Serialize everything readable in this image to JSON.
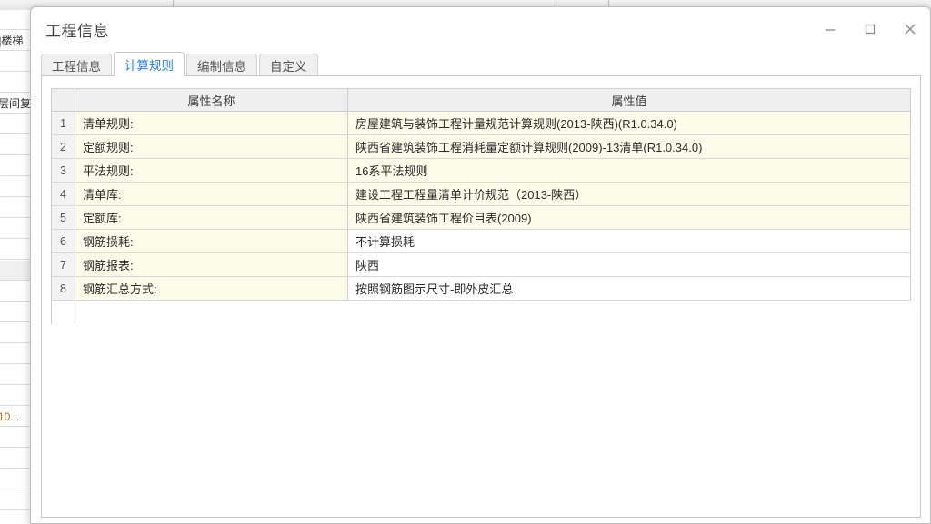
{
  "background_window": {
    "toolbar_separators": [
      190,
      611,
      669
    ],
    "side_rows": [
      {
        "text": "",
        "shaded": false,
        "header": false,
        "orange": false
      },
      {
        "text": "]楼梯",
        "shaded": false,
        "header": false,
        "orange": false
      },
      {
        "text": "",
        "shaded": false,
        "header": false,
        "orange": false
      },
      {
        "text": "",
        "shaded": false,
        "header": false,
        "orange": false
      },
      {
        "text": "层间复",
        "shaded": false,
        "header": false,
        "orange": false
      },
      {
        "text": "",
        "shaded": false,
        "header": false,
        "orange": false
      },
      {
        "text": "",
        "shaded": false,
        "header": false,
        "orange": false
      },
      {
        "text": "",
        "shaded": false,
        "header": false,
        "orange": false
      },
      {
        "text": "",
        "shaded": false,
        "header": false,
        "orange": false
      },
      {
        "text": "",
        "shaded": false,
        "header": false,
        "orange": false
      },
      {
        "text": "",
        "shaded": false,
        "header": false,
        "orange": false
      },
      {
        "text": "",
        "shaded": false,
        "header": false,
        "orange": false
      },
      {
        "text": "",
        "shaded": true,
        "header": false,
        "orange": false
      },
      {
        "text": "",
        "shaded": false,
        "header": false,
        "orange": false
      },
      {
        "text": "",
        "shaded": false,
        "header": false,
        "orange": false
      },
      {
        "text": "",
        "shaded": false,
        "header": false,
        "orange": false
      },
      {
        "text": "",
        "shaded": false,
        "header": false,
        "orange": false
      },
      {
        "text": "",
        "shaded": false,
        "header": false,
        "orange": false
      },
      {
        "text": "",
        "shaded": false,
        "header": false,
        "orange": false
      },
      {
        "text": "10...",
        "shaded": false,
        "header": false,
        "orange": true
      },
      {
        "text": "",
        "shaded": false,
        "header": false,
        "orange": false
      },
      {
        "text": "",
        "shaded": false,
        "header": false,
        "orange": false
      },
      {
        "text": "",
        "shaded": false,
        "header": false,
        "orange": false
      },
      {
        "text": "",
        "shaded": false,
        "header": false,
        "orange": false
      },
      {
        "text": "",
        "shaded": false,
        "header": false,
        "orange": false
      }
    ]
  },
  "dialog": {
    "title": "工程信息",
    "window_controls": {
      "minimize": "minimize",
      "maximize": "maximize",
      "close": "close"
    },
    "tabs": [
      {
        "label": "工程信息",
        "active": false
      },
      {
        "label": "计算规则",
        "active": true
      },
      {
        "label": "编制信息",
        "active": false
      },
      {
        "label": "自定义",
        "active": false
      }
    ],
    "grid": {
      "columns": [
        "",
        "属性名称",
        "属性值"
      ],
      "rows": [
        {
          "index": "1",
          "name": "清单规则:",
          "value": "房屋建筑与装饰工程计量规范计算规则(2013-陕西)(R1.0.34.0)",
          "value_highlight": true
        },
        {
          "index": "2",
          "name": "定额规则:",
          "value": "陕西省建筑装饰工程消耗量定额计算规则(2009)-13清单(R1.0.34.0)",
          "value_highlight": true
        },
        {
          "index": "3",
          "name": "平法规则:",
          "value": "16系平法规则",
          "value_highlight": true
        },
        {
          "index": "4",
          "name": "清单库:",
          "value": "建设工程工程量清单计价规范（2013-陕西）",
          "value_highlight": true
        },
        {
          "index": "5",
          "name": "定额库:",
          "value": "陕西省建筑装饰工程价目表(2009)",
          "value_highlight": true
        },
        {
          "index": "6",
          "name": "钢筋损耗:",
          "value": "不计算损耗",
          "value_highlight": false
        },
        {
          "index": "7",
          "name": "钢筋报表:",
          "value": "陕西",
          "value_highlight": false
        },
        {
          "index": "8",
          "name": "钢筋汇总方式:",
          "value": "按照钢筋图示尺寸-即外皮汇总",
          "value_highlight": false
        }
      ]
    }
  },
  "colors": {
    "accent": "#2f7fd1",
    "row_highlight": "#fcfbe9",
    "header_bg": "#efefef",
    "grid_line": "#cccccc",
    "orange_text": "#c76b1a"
  }
}
